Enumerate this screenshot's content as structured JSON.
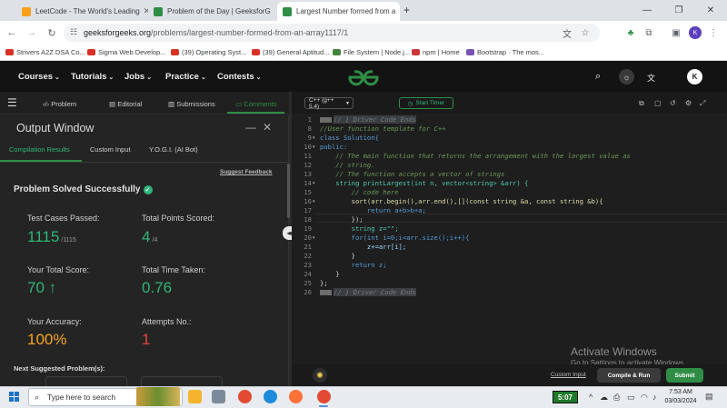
{
  "browser": {
    "tabs": [
      {
        "title": "LeetCode - The World's Leading",
        "active": false
      },
      {
        "title": "Problem of the Day | GeeksforG",
        "active": false
      },
      {
        "title": "Largest Number formed from a",
        "active": true
      }
    ],
    "new_tab": "+",
    "url_host": "geeksforgeeks.org",
    "url_path": "/problems/largest-number-formed-from-an-array1117/1",
    "profile_initial": "K",
    "bookmarks": [
      "Strivers A2Z DSA Co...",
      "Sigma Web Develop...",
      "(39) Operating Syst...",
      "(39) General Aptitud...",
      "File System | Node.j...",
      "npm | Home",
      "Bootstrap · The mos..."
    ]
  },
  "site": {
    "menus": [
      "Courses",
      "Tutorials",
      "Jobs",
      "Practice",
      "Contests"
    ],
    "avatar_initial": "K"
  },
  "left_tabs": [
    "Problem",
    "Editorial",
    "Submissions",
    "Comments"
  ],
  "output": {
    "title": "Output Window",
    "tabs": [
      "Compilation Results",
      "Custom Input",
      "Y.O.G.I. (AI Bot)"
    ],
    "suggest_feedback": "Suggest Feedback",
    "status": "Problem Solved Successfully",
    "test_cases_label": "Test Cases Passed:",
    "test_cases_value": "1115",
    "test_cases_total": "/1115",
    "points_label": "Total Points Scored:",
    "points_value": "4",
    "points_total": "/4",
    "score_label": "Your Total Score:",
    "score_value": "70",
    "time_label": "Total Time Taken:",
    "time_value": "0.76",
    "accuracy_label": "Your Accuracy:",
    "accuracy_value": "100%",
    "attempts_label": "Attempts No.:",
    "attempts_value": "1",
    "next_suggested": "Next Suggested Problem(s):"
  },
  "editor": {
    "language": "C++ (g++ 5.4)",
    "timer_label": "Start Timer",
    "line_numbers": [
      "1",
      "8",
      "9",
      "10",
      "11",
      "12",
      "13",
      "14",
      "15",
      "16",
      "17",
      "18",
      "19",
      "20",
      "21",
      "22",
      "23",
      "24",
      "25",
      "26"
    ],
    "lines": [
      "// } Driver Code Ends",
      "//User function template for C++",
      "class Solution{",
      "public:",
      "    // The main function that returns the arrangement with the largest value as",
      "    // string.",
      "    // The function accepts a vector of strings",
      "    string printLargest(int n, vector<string> &arr) {",
      "        // code here",
      "        sort(arr.begin(),arr.end(),[](const string &a, const string &b){",
      "            return a+b>b+a;",
      "        });",
      "        string z=\"\";",
      "        for(int i=0;i<arr.size();i++){",
      "            z+=arr[i];",
      "        }",
      "        return z;",
      "    }",
      "};",
      "// } Driver Code Ends"
    ],
    "custom_input": "Custom Input",
    "compile_run": "Compile & Run",
    "submit": "Submit"
  },
  "watermark": {
    "line1": "Activate Windows",
    "line2": "Go to Settings to activate Windows."
  },
  "taskbar": {
    "search_placeholder": "Type here to search",
    "badge_time": "5:07",
    "time": "7:53 AM",
    "date": "03/03/2024"
  },
  "colors": {
    "accent_green": "#2f8d46",
    "success_green": "#2fb57a",
    "accuracy_orange": "#f5a623",
    "attempts_red": "#e8453c"
  }
}
